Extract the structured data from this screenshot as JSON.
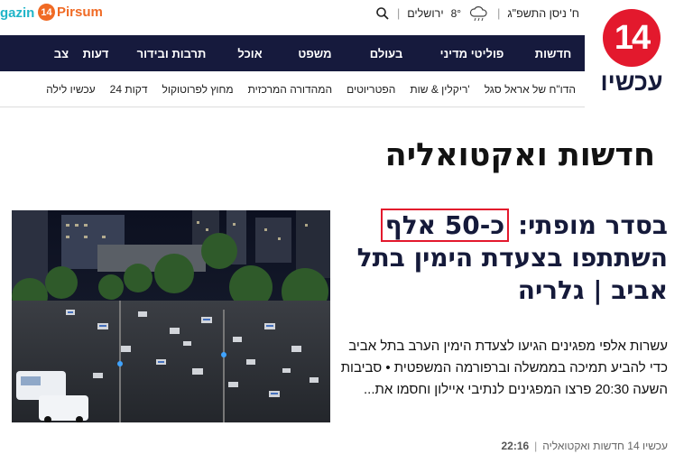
{
  "top_bar": {
    "brand_partial": "gazin",
    "pirsum_badge": "14",
    "pirsum_label": "Pirsum",
    "date": "ח' ניסן התשפ\"ג",
    "temperature": "8°",
    "city": "ירושלים"
  },
  "logo": {
    "number": "14",
    "name": "עכשיו",
    "color": "#e3192d"
  },
  "main_nav": [
    "חדשות",
    "פוליטי מדיני",
    "בעולם",
    "משפט",
    "אוכל",
    "תרבות ובידור",
    "דעות",
    "צב"
  ],
  "sub_nav": [
    "הדו\"ח של אראל סגל",
    "ריקלין & שות'",
    "הפטריוטים",
    "המהדורה המרכזית",
    "מחוץ לפרוטוקול",
    "24 דקות",
    "עכשיו לילה"
  ],
  "section": {
    "title": "חדשות ואקטואליה"
  },
  "article": {
    "headline_start": "בסדר מופתי: ",
    "headline_highlight": "כ-50 אלף",
    "headline_end": " השתתפו בצעדת הימין בתל אביב | גלריה",
    "summary": "עשרות אלפי מפגינים הגיעו לצעדת הימין הערב בתל אביב כדי להביע תמיכה בממשלה וברפורמה המשפטית • סביבות השעה 20:30 פרצו המפגינים לנתיבי איילון וחסמו את...",
    "source": "עכשיו 14 חדשות ואקטואליה",
    "time": "22:16"
  },
  "colors": {
    "nav_bg": "#161a3d",
    "brand_red": "#e3192d",
    "pirsum_orange": "#f06a24",
    "magazin_teal": "#20b5c8"
  }
}
